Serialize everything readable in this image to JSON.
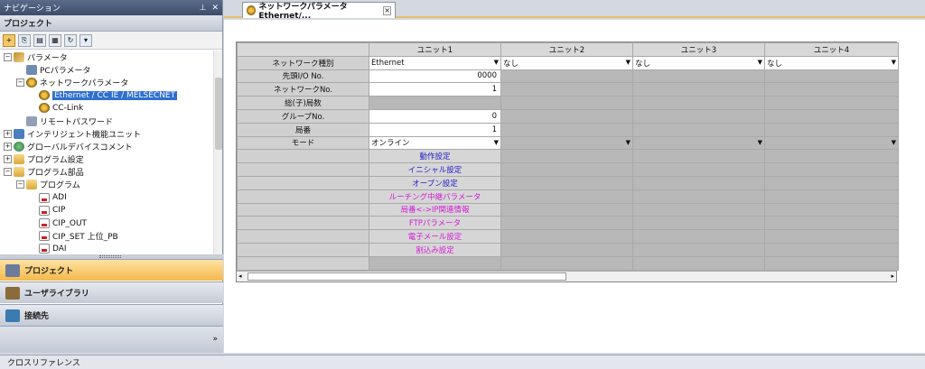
{
  "navigation": {
    "title": "ナビゲーション",
    "pin_icon": "pin-icon",
    "close_icon": "close-icon",
    "section_header": "プロジェクト",
    "tree": [
      {
        "label": "パラメータ",
        "level": 0,
        "toggle": "⊟",
        "icon": "par"
      },
      {
        "label": "PCパラメータ",
        "level": 1,
        "toggle": "",
        "icon": "pc"
      },
      {
        "label": "ネットワークパラメータ",
        "level": 1,
        "toggle": "⊟",
        "icon": "net"
      },
      {
        "label": "Ethernet / CC IE / MELSECNET",
        "level": 2,
        "toggle": "",
        "icon": "net",
        "selected": true
      },
      {
        "label": "CC-Link",
        "level": 2,
        "toggle": "",
        "icon": "net"
      },
      {
        "label": "リモートパスワード",
        "level": 1,
        "toggle": "",
        "icon": "key"
      },
      {
        "label": "インテリジェント機能ユニット",
        "level": 0,
        "toggle": "⊞",
        "icon": "io"
      },
      {
        "label": "グローバルデバイスコメント",
        "level": 0,
        "toggle": "⊞",
        "icon": "glob"
      },
      {
        "label": "プログラム設定",
        "level": 0,
        "toggle": "⊞",
        "icon": "folder"
      },
      {
        "label": "プログラム部品",
        "level": 0,
        "toggle": "⊟",
        "icon": "folder"
      },
      {
        "label": "プログラム",
        "level": 1,
        "toggle": "⊟",
        "icon": "folder"
      },
      {
        "label": "ADI",
        "level": 2,
        "toggle": "",
        "icon": "doc"
      },
      {
        "label": "CIP",
        "level": 2,
        "toggle": "",
        "icon": "doc"
      },
      {
        "label": "CIP_OUT",
        "level": 2,
        "toggle": "",
        "icon": "doc"
      },
      {
        "label": "CIP_SET 上位_PB",
        "level": 2,
        "toggle": "",
        "icon": "doc"
      },
      {
        "label": "DAI",
        "level": 2,
        "toggle": "",
        "icon": "doc"
      }
    ],
    "buttons": [
      {
        "label": "プロジェクト",
        "active": true
      },
      {
        "label": "ユーザライブラリ",
        "active": false
      },
      {
        "label": "接続先",
        "active": false
      }
    ],
    "expand_arrow": "»"
  },
  "tab": {
    "title": "ネットワークパラメータ Ethernet/...",
    "close": "×"
  },
  "grid": {
    "columns": [
      "",
      "ユニット1",
      "ユニット2",
      "ユニット3",
      "ユニット4"
    ],
    "rows": [
      {
        "label": "ネットワーク種別",
        "cells": [
          "Ethernet",
          "なし",
          "なし",
          "なし"
        ],
        "type": "select"
      },
      {
        "label": "先頭I/O No.",
        "cells": [
          "0000",
          "",
          "",
          ""
        ],
        "type": "num"
      },
      {
        "label": "ネットワークNo.",
        "cells": [
          "1",
          "",
          "",
          ""
        ],
        "type": "num"
      },
      {
        "label": "総(子)局数",
        "cells": [
          "",
          "",
          "",
          ""
        ],
        "type": "gray"
      },
      {
        "label": "グループNo.",
        "cells": [
          "0",
          "",
          "",
          ""
        ],
        "type": "num"
      },
      {
        "label": "局番",
        "cells": [
          "1",
          "",
          "",
          ""
        ],
        "type": "num"
      },
      {
        "label": "モード",
        "cells": [
          "オンライン",
          "",
          "",
          ""
        ],
        "type": "select"
      }
    ],
    "links": [
      {
        "label": "動作設定",
        "color": "blue"
      },
      {
        "label": "イニシャル設定",
        "color": "blue"
      },
      {
        "label": "オープン設定",
        "color": "blue"
      },
      {
        "label": "ルーチング中継パラメータ",
        "color": "pink"
      },
      {
        "label": "局番<->IP関連情報",
        "color": "pink"
      },
      {
        "label": "FTPパラメータ",
        "color": "pink"
      },
      {
        "label": "電子メール設定",
        "color": "pink"
      },
      {
        "label": "割込み設定",
        "color": "pink"
      }
    ]
  },
  "statusbar": {
    "label": "クロスリファレンス"
  }
}
